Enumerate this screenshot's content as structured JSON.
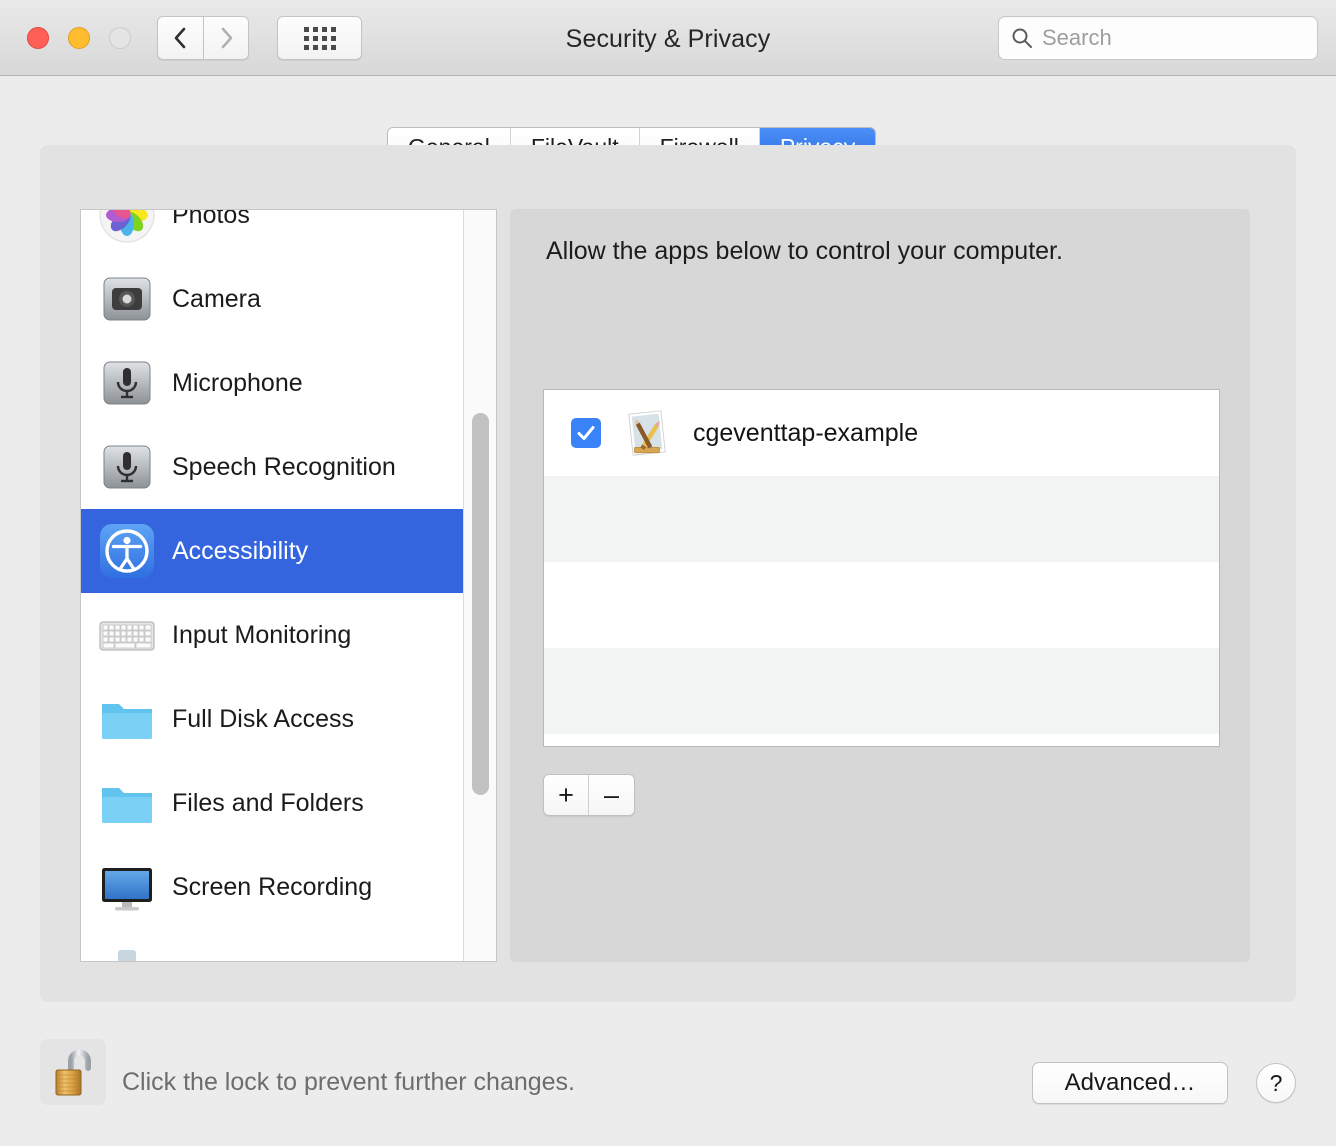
{
  "window": {
    "title": "Security & Privacy",
    "traffic_lights": [
      "close",
      "minimize",
      "zoom"
    ],
    "nav": {
      "back": "back-chevron",
      "forward": "forward-chevron",
      "grid": "show-all-grid"
    },
    "search": {
      "placeholder": "Search",
      "value": "",
      "icon": "search-icon"
    }
  },
  "tabs": [
    {
      "label": "General",
      "active": false
    },
    {
      "label": "FileVault",
      "active": false
    },
    {
      "label": "Firewall",
      "active": false
    },
    {
      "label": "Privacy",
      "active": true
    }
  ],
  "sidebar": {
    "items": [
      {
        "label": "Photos",
        "icon": "photos-icon",
        "selected": false
      },
      {
        "label": "Camera",
        "icon": "camera-icon",
        "selected": false
      },
      {
        "label": "Microphone",
        "icon": "microphone-icon",
        "selected": false
      },
      {
        "label": "Speech Recognition",
        "icon": "microphone-icon",
        "selected": false
      },
      {
        "label": "Accessibility",
        "icon": "accessibility-icon",
        "selected": true
      },
      {
        "label": "Input Monitoring",
        "icon": "keyboard-icon",
        "selected": false
      },
      {
        "label": "Full Disk Access",
        "icon": "folder-icon",
        "selected": false
      },
      {
        "label": "Files and Folders",
        "icon": "folder-icon",
        "selected": false
      },
      {
        "label": "Screen Recording",
        "icon": "display-icon",
        "selected": false
      }
    ],
    "scrollbar": "vertical-scrollbar"
  },
  "content": {
    "heading": "Allow the apps below to control your computer.",
    "rows": [
      {
        "name": "cgeventtap-example",
        "checked": true,
        "icon": "generic-app-icon"
      },
      {
        "name": "",
        "checked": null,
        "icon": ""
      },
      {
        "name": "",
        "checked": null,
        "icon": ""
      },
      {
        "name": "",
        "checked": null,
        "icon": ""
      },
      {
        "name": "",
        "checked": null,
        "icon": ""
      }
    ],
    "add_label": "+",
    "remove_label": "–"
  },
  "bottom": {
    "lock_icon": "unlocked-padlock-icon",
    "lock_text": "Click the lock to prevent further changes.",
    "advanced_label": "Advanced…",
    "help_label": "?"
  },
  "colors": {
    "accent_blue": "#3465df",
    "tab_active_blue": "#2c6be0",
    "checkbox_blue": "#3a82f7",
    "window_bg": "#ececec",
    "panel_bg": "#e2e2e2"
  }
}
